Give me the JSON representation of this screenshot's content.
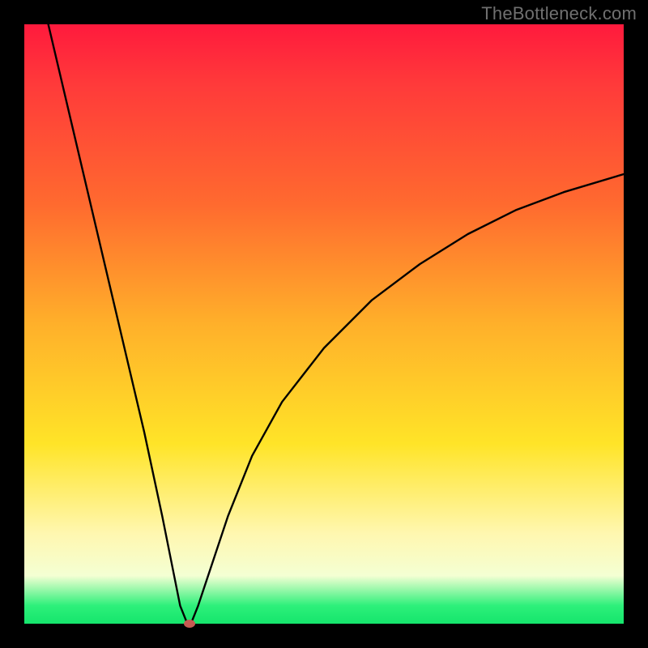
{
  "attribution": "TheBottleneck.com",
  "colors": {
    "frame": "#000000",
    "gradient_stops": [
      "#ff1a3d",
      "#ff3a3a",
      "#ff6a2f",
      "#ffb02a",
      "#ffe428",
      "#fff7b0",
      "#f4ffd3",
      "#2df07a",
      "#15e56c"
    ],
    "curve": "#000000",
    "marker": "#c65a52"
  },
  "chart_data": {
    "type": "line",
    "title": "",
    "xlabel": "",
    "ylabel": "",
    "xlim": [
      0,
      100
    ],
    "ylim": [
      0,
      100
    ],
    "grid": false,
    "legend": false,
    "notes": "V-shaped bottleneck curve on rainbow gradient; minimum near x≈27 at y≈0; left branch descends steeply from near y=100 at x≈4; right branch rises concavely toward y≈75 at x=100.",
    "series": [
      {
        "name": "bottleneck-curve",
        "x": [
          4,
          8,
          12,
          16,
          20,
          23,
          25,
          26,
          27,
          27.5,
          28,
          29,
          31,
          34,
          38,
          43,
          50,
          58,
          66,
          74,
          82,
          90,
          100
        ],
        "y": [
          100,
          83,
          66,
          49,
          32,
          18,
          8,
          3,
          0.5,
          0,
          0.5,
          3,
          9,
          18,
          28,
          37,
          46,
          54,
          60,
          65,
          69,
          72,
          75
        ]
      }
    ],
    "marker": {
      "x": 27.5,
      "y": 0
    }
  }
}
